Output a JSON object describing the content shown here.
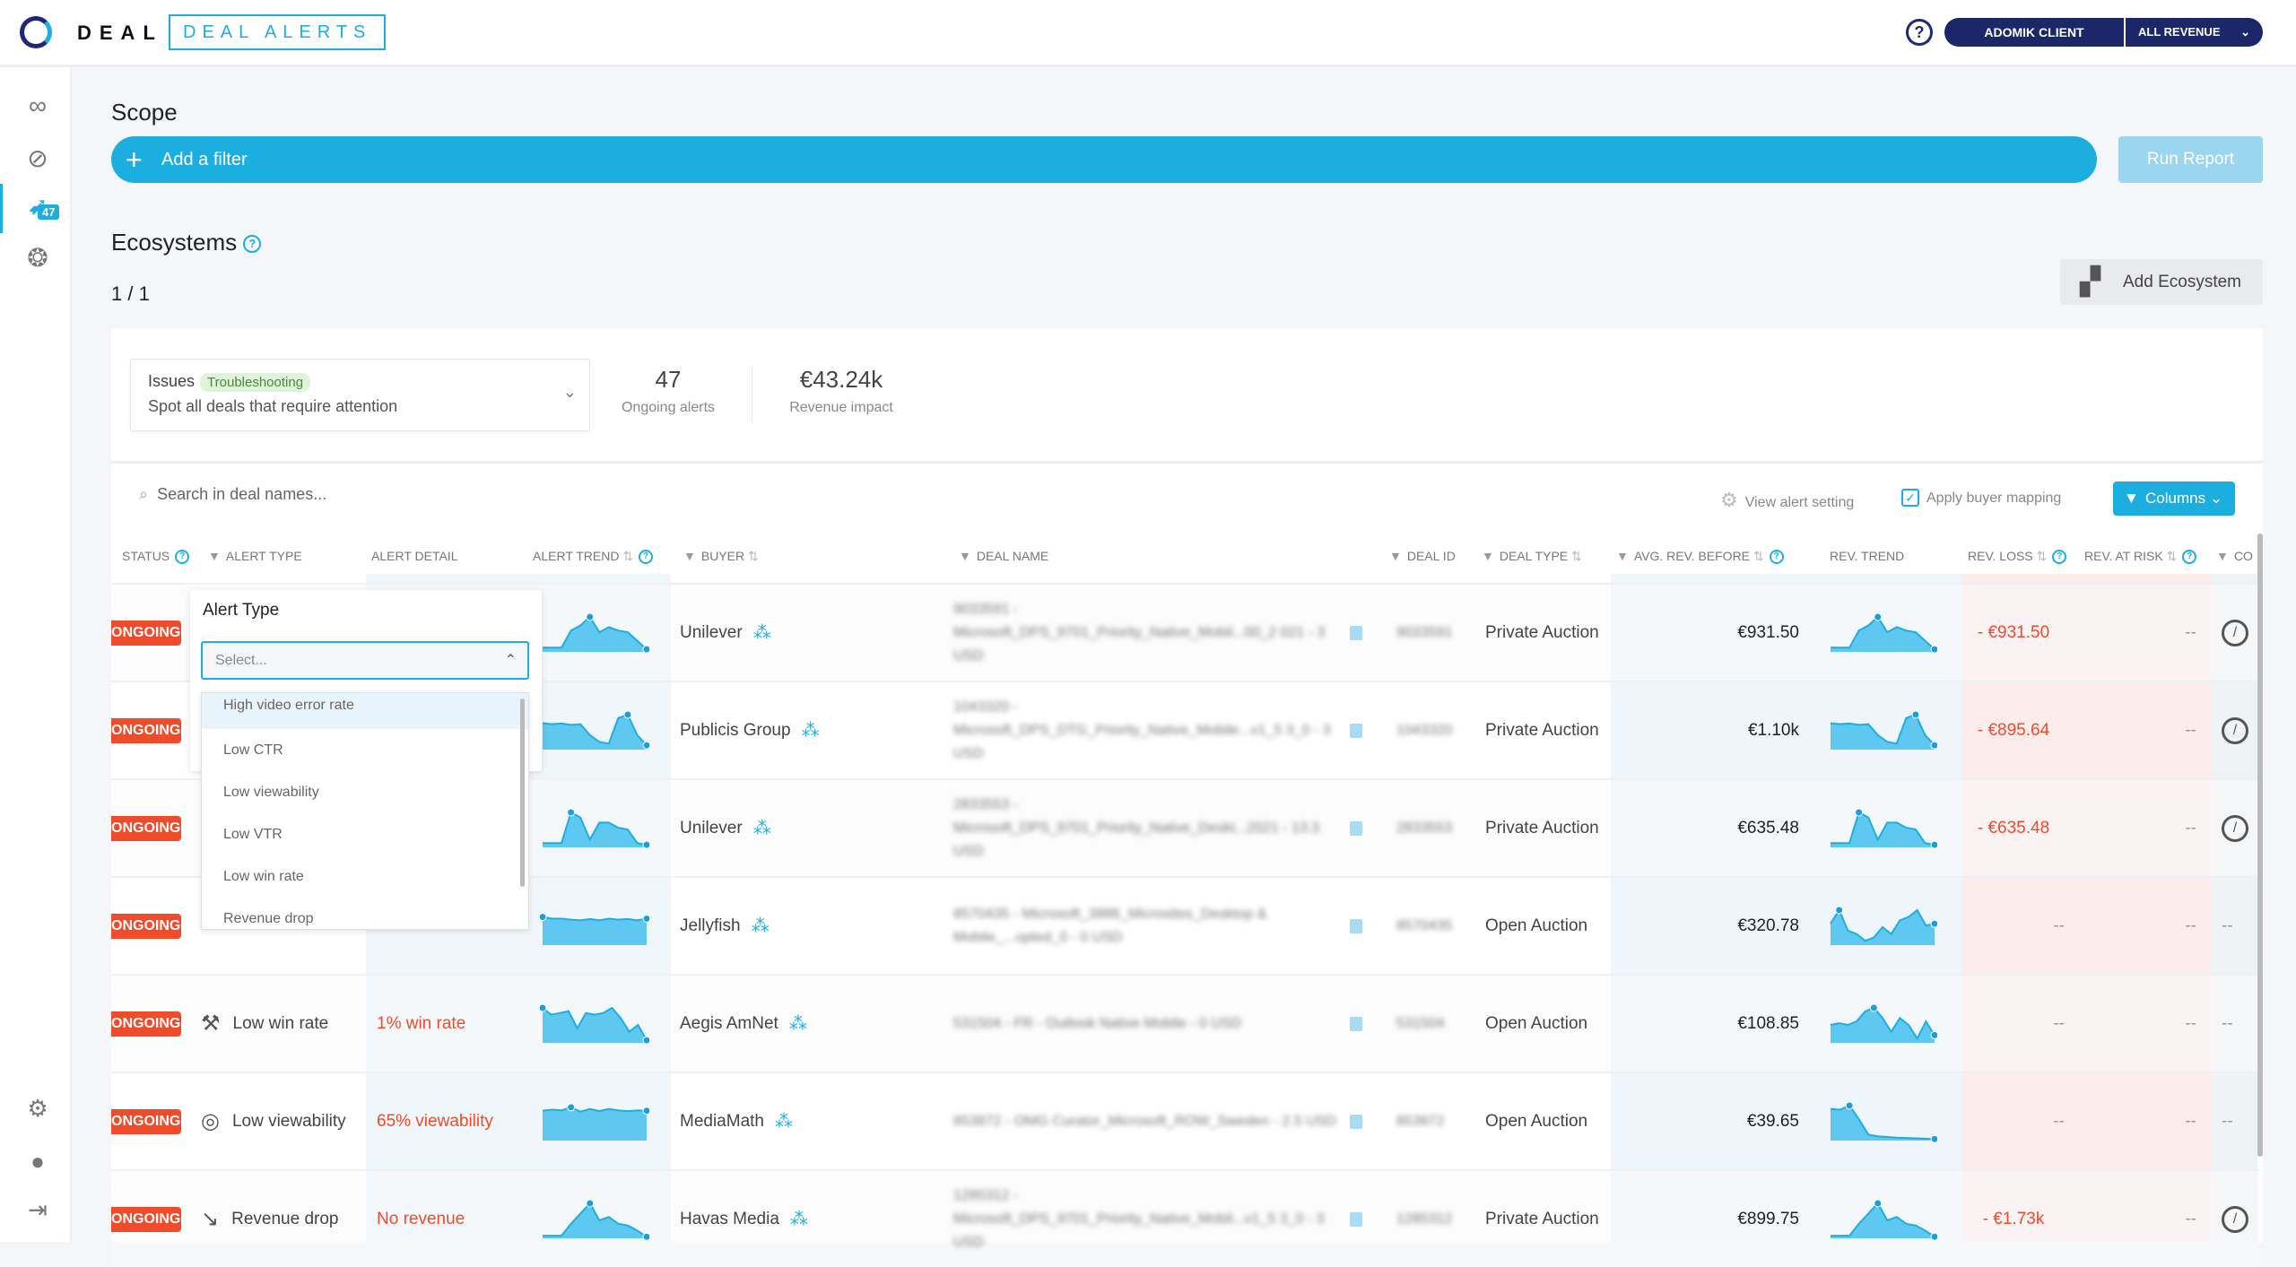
{
  "header": {
    "brand": "DEAL",
    "product": "DEAL ALERTS",
    "client": "ADOMIK CLIENT",
    "revenue_select": "ALL REVENUE"
  },
  "sidebar": {
    "items": [
      {
        "icon": "glasses-icon"
      },
      {
        "icon": "compass-icon"
      },
      {
        "icon": "alert-icon",
        "badge": "47"
      },
      {
        "icon": "lifebuoy-icon"
      }
    ],
    "bottom": [
      {
        "icon": "gear-icon"
      },
      {
        "icon": "user-icon"
      },
      {
        "icon": "logout-icon"
      }
    ]
  },
  "scope": {
    "title": "Scope",
    "add_filter": "Add a filter",
    "run_report": "Run Report"
  },
  "ecosystems": {
    "title": "Ecosystems",
    "pagination": "1 / 1",
    "add_button": "Add Ecosystem"
  },
  "ecosystem_card": {
    "name": "Issues",
    "tag": "Troubleshooting",
    "description": "Spot all deals that require attention",
    "alerts_value": "47",
    "alerts_label": "Ongoing alerts",
    "impact_value": "€43.24k",
    "impact_label": "Revenue impact"
  },
  "toolbar": {
    "search_placeholder": "Search in deal names...",
    "view_alert_setting": "View alert setting",
    "apply_buyer_mapping": "Apply buyer mapping",
    "apply_buyer_mapping_checked": true,
    "columns": "Columns"
  },
  "table": {
    "headers": [
      "STATUS",
      "ALERT TYPE",
      "ALERT DETAIL",
      "ALERT TREND",
      "BUYER",
      "DEAL NAME",
      "DEAL ID",
      "DEAL TYPE",
      "AVG. REV. BEFORE",
      "REV. TREND",
      "REV. LOSS",
      "REV. AT RISK",
      "CO"
    ],
    "rows": [
      {
        "status": "ONGOING",
        "alert_type": "",
        "alert_detail": "",
        "alert_trend": [
          0.1,
          0.1,
          0.1,
          0.6,
          0.75,
          1,
          0.55,
          0.7,
          0.6,
          0.55,
          0.3,
          0.05
        ],
        "buyer": "Unilever",
        "deal_name": "9033591 - Microsoft_DPS_9701_Priority_Native_Mobil...00_2 021 - 3 USD",
        "deal_id": "9033591",
        "deal_type": "Private Auction",
        "avg_rev_before": "€931.50",
        "rev_trend": [
          0.1,
          0.1,
          0.1,
          0.6,
          0.75,
          1,
          0.55,
          0.7,
          0.6,
          0.55,
          0.3,
          0.05
        ],
        "rev_loss": "- €931.50",
        "rev_at_risk": "--",
        "action": "compass"
      },
      {
        "status": "ONGOING",
        "alert_type": "",
        "alert_detail": "",
        "alert_trend": [
          0.75,
          0.72,
          0.74,
          0.7,
          0.72,
          0.4,
          0.2,
          0.15,
          0.9,
          1,
          0.4,
          0.1
        ],
        "buyer": "Publicis Group",
        "deal_name": "1043320 - Microsoft_DPS_DTG_Priority_Native_Mobile...v1_5 3_0 - 3 USD",
        "deal_id": "1043320",
        "deal_type": "Private Auction",
        "avg_rev_before": "€1.10k",
        "rev_trend": [
          0.75,
          0.72,
          0.74,
          0.7,
          0.72,
          0.4,
          0.2,
          0.15,
          0.9,
          1,
          0.4,
          0.1
        ],
        "rev_loss": "- €895.64",
        "rev_at_risk": "--",
        "action": "compass"
      },
      {
        "status": "ONGOING",
        "alert_type": "",
        "alert_detail": "",
        "alert_trend": [
          0.1,
          0.1,
          0.1,
          1,
          0.85,
          0.2,
          0.7,
          0.7,
          0.55,
          0.5,
          0.1,
          0.05
        ],
        "buyer": "Unilever",
        "deal_name": "2833553 - Microsoft_DPS_9701_Priority_Native_Deskt...2021 - 13.3 USD",
        "deal_id": "2833553",
        "deal_type": "Private Auction",
        "avg_rev_before": "€635.48",
        "rev_trend": [
          0.1,
          0.1,
          0.1,
          1,
          0.85,
          0.2,
          0.7,
          0.7,
          0.55,
          0.5,
          0.1,
          0.05
        ],
        "rev_loss": "- €635.48",
        "rev_at_risk": "--",
        "action": "compass"
      },
      {
        "status": "ONGOING",
        "alert_type": "",
        "alert_detail": "",
        "alert_trend": [
          0.8,
          0.75,
          0.75,
          0.72,
          0.7,
          0.74,
          0.7,
          0.75,
          0.72,
          0.74,
          0.7,
          0.75
        ],
        "buyer": "Jellyfish",
        "deal_name": "8570435 - Microsoft_3886_Microsites_Desktop & Mobile_...opted_0 - 0 USD",
        "deal_id": "8570435",
        "deal_type": "Open Auction",
        "avg_rev_before": "€320.78",
        "rev_trend": [
          0.6,
          1,
          0.4,
          0.3,
          0.1,
          0.2,
          0.5,
          0.3,
          0.7,
          0.8,
          1,
          0.55,
          0.6
        ],
        "rev_loss": "--",
        "rev_at_risk": "--",
        "action": "--"
      },
      {
        "status": "ONGOING",
        "alert_type": "Low win rate",
        "alert_type_icon": "gavel-icon",
        "alert_detail": "1% win rate",
        "alert_trend": [
          1,
          0.8,
          0.85,
          0.9,
          0.4,
          0.85,
          0.8,
          0.85,
          1,
          0.7,
          0.3,
          0.5,
          0.05
        ],
        "buyer": "Aegis AmNet",
        "deal_name": "531504 - FR - Outlook Native Mobile - 0 USD",
        "deal_id": "531504",
        "deal_type": "Open Auction",
        "avg_rev_before": "€108.85",
        "rev_trend": [
          0.5,
          0.55,
          0.5,
          0.6,
          0.9,
          1,
          0.7,
          0.3,
          0.7,
          0.5,
          0.1,
          0.6,
          0.2
        ],
        "rev_loss": "--",
        "rev_at_risk": "--",
        "action": "--"
      },
      {
        "status": "ONGOING",
        "alert_type": "Low viewability",
        "alert_type_icon": "eye-icon",
        "alert_detail": "65% viewability",
        "alert_trend": [
          0.85,
          0.88,
          0.86,
          0.95,
          0.82,
          0.9,
          0.84,
          0.9,
          0.86,
          0.84,
          0.86,
          0.85
        ],
        "buyer": "MediaMath",
        "deal_name": "853872 - OMG Curator_Microsoft_ROW_Sweden - 2.5 USD",
        "deal_id": "853872",
        "deal_type": "Open Auction",
        "avg_rev_before": "€39.65",
        "rev_trend": [
          0.9,
          0.88,
          1,
          0.6,
          0.15,
          0.1,
          0.08,
          0.06,
          0.05,
          0.04,
          0.03,
          0.02
        ],
        "rev_loss": "--",
        "rev_at_risk": "--",
        "action": "--"
      },
      {
        "status": "ONGOING",
        "alert_type": "Revenue drop",
        "alert_type_icon": "trend-down-icon",
        "alert_detail": "No revenue",
        "alert_trend": [
          0.05,
          0.05,
          0.05,
          0.4,
          0.7,
          1,
          0.5,
          0.6,
          0.4,
          0.35,
          0.2,
          0.02
        ],
        "buyer": "Havas Media",
        "deal_name": "1285312 - Microsoft_DPS_9701_Priority_Native_Mobil...v1_5 3_0 - 3 USD",
        "deal_id": "1285312",
        "deal_type": "Private Auction",
        "avg_rev_before": "€899.75",
        "rev_trend": [
          0.05,
          0.05,
          0.05,
          0.4,
          0.7,
          1,
          0.5,
          0.6,
          0.4,
          0.35,
          0.2,
          0.02
        ],
        "rev_loss": "- €1.73k",
        "rev_at_risk": "--",
        "action": "compass"
      }
    ]
  },
  "alert_type_dropdown": {
    "title": "Alert Type",
    "placeholder": "Select...",
    "options": [
      "High video error rate",
      "Low CTR",
      "Low viewability",
      "Low VTR",
      "Low win rate",
      "Revenue drop"
    ],
    "highlighted": "High video error rate"
  },
  "colors": {
    "accent": "#1daee0",
    "navy": "#1b2768",
    "alert_red": "#f04b2a",
    "loss_bg": "#fdecec",
    "metric_bg": "#eef6fb"
  }
}
